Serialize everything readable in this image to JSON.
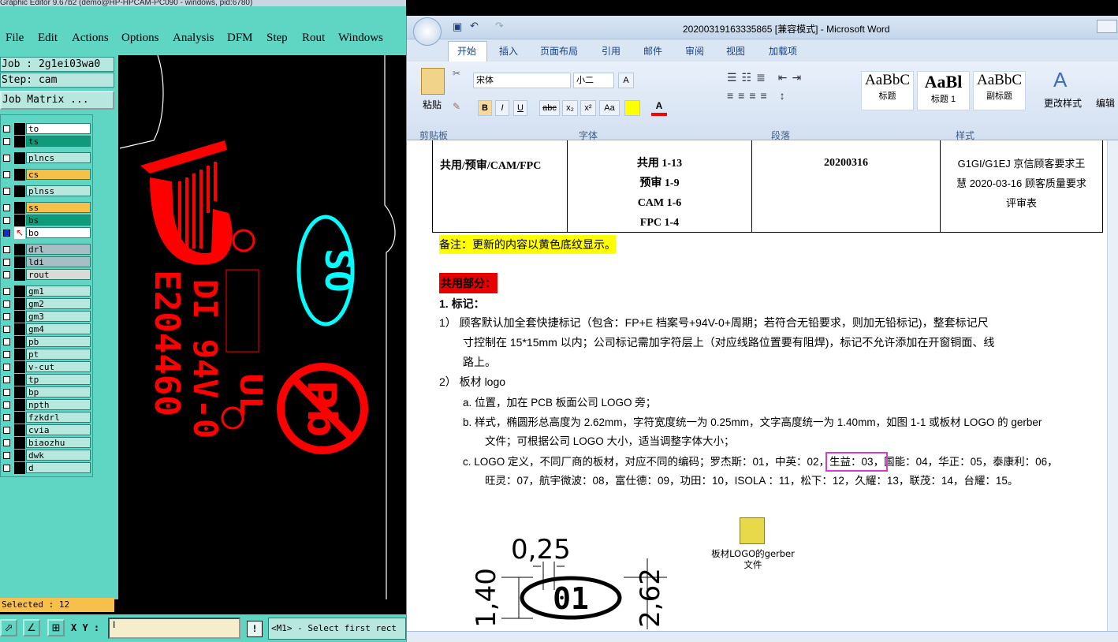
{
  "genesis": {
    "title": "Graphic Editor 9.67b2 (demo@HP-HPCAM-PC090 - windows, pid:6780)",
    "menu": [
      "File",
      "Edit",
      "Actions",
      "Options",
      "Analysis",
      "DFM",
      "Step",
      "Rout",
      "Windows"
    ],
    "job_label": "Job : 2g1ei03wa0",
    "step_label": "Step: cam",
    "job_matrix_button": "Job Matrix ...",
    "layers": [
      {
        "name": "to",
        "color": "#ffffff"
      },
      {
        "name": "ts",
        "color": "#0e9b7a"
      },
      {
        "name": "plncs",
        "color": "#b7e7df"
      },
      {
        "name": "cs",
        "color": "#f7c04a"
      },
      {
        "name": "plnss",
        "color": "#b7e7df"
      },
      {
        "name": "ss",
        "color": "#f7c04a"
      },
      {
        "name": "bs",
        "color": "#0e9b7a"
      },
      {
        "name": "bo",
        "color": "#ffffff"
      },
      {
        "name": "drl",
        "color": "#a7bfc4"
      },
      {
        "name": "ldi",
        "color": "#a7bfc4"
      },
      {
        "name": "rout",
        "color": "#d8dcd6"
      },
      {
        "name": "gm1",
        "color": "#b7e7df"
      },
      {
        "name": "gm2",
        "color": "#b7e7df"
      },
      {
        "name": "gm3",
        "color": "#b7e7df"
      },
      {
        "name": "gm4",
        "color": "#b7e7df"
      },
      {
        "name": "pb",
        "color": "#b7e7df"
      },
      {
        "name": "pt",
        "color": "#b7e7df"
      },
      {
        "name": "v-cut",
        "color": "#b7e7df"
      },
      {
        "name": "tp",
        "color": "#b7e7df"
      },
      {
        "name": "bp",
        "color": "#b7e7df"
      },
      {
        "name": "npth",
        "color": "#b7e7df"
      },
      {
        "name": "fzkdrl",
        "color": "#b7e7df"
      },
      {
        "name": "cvia",
        "color": "#b7e7df"
      },
      {
        "name": "biaozhu",
        "color": "#b7e7df"
      },
      {
        "name": "dwk",
        "color": "#b7e7df"
      },
      {
        "name": "d",
        "color": "#b7e7df"
      }
    ],
    "selected": "Selected : 12",
    "xy_label": "X Y :",
    "xy_value": "I",
    "excl": "!",
    "prompt": "<M1> - Select first rect",
    "canvas_text": {
      "os_logo": "OS",
      "os_logo_mirror": "SO",
      "board_code": "E204460",
      "ul_mark": "DI 94V-0",
      "date": "0-V49"
    }
  },
  "word": {
    "title": "20200319163335865 [兼容模式] - Microsoft Word",
    "tabs": [
      "开始",
      "插入",
      "页面布局",
      "引用",
      "邮件",
      "审阅",
      "视图",
      "加载项"
    ],
    "ribbon": {
      "paste": "粘贴",
      "clipboard": "剪贴板",
      "font_name": "宋体",
      "font_size": "小二",
      "font_group": "字体",
      "para_group": "段落",
      "style_group": "样式",
      "styles": [
        {
          "preview": "AaBbC",
          "label": "标题"
        },
        {
          "preview": "AaBl",
          "label": "标题 1"
        },
        {
          "preview": "AaBbC",
          "label": "副标题"
        }
      ],
      "change_styles": "更改样式",
      "edit": "编辑",
      "grow": "A",
      "bold": "B",
      "italic": "I",
      "underline": "U",
      "strike": "abc",
      "sub": "x₂",
      "sup": "x²",
      "case": "Aa"
    },
    "table": {
      "c1": "共用/预审/CAM/FPC",
      "c2": [
        "共用 1-13",
        "预审 1-9",
        "CAM 1-6",
        "FPC 1-4"
      ],
      "c3": "20200316",
      "c4": [
        "G1GI/G1EJ 京信顾客要求王",
        "慧 2020-03-16 顾客质量要求",
        "评审表"
      ]
    },
    "note": "备注：更新的内容以黄色底纹显示。",
    "section": "共用部分：",
    "h1": "1.   标记：",
    "p1": [
      "1） 顾客默认加全套快捷标记（包含：FP+E  档案号+94V-0+周期；若符合无铅要求，则加无铅标记)，整套标记尺",
      "寸控制在 15*15mm 以内；公司标记需加字符层上（对应线路位置要有阻焊)，标记不允许添加在开窗铜面、线",
      "路上。"
    ],
    "p2": "2） 板材 logo",
    "pa": "a.   位置，加在 PCB 板面公司 LOGO 旁；",
    "pb": [
      "b.   样式，椭圆形总高度为 2.62mm，字符宽度统一为 0.25mm，文字高度统一为 1.40mm，如图 1-1 或板材 LOGO 的 gerber",
      "文件；可根据公司 LOGO 大小，适当调整字体大小；"
    ],
    "pc1_pre": "c.   LOGO 定义，不同厂商的板材，对应不同的编码；罗杰斯：01，中英：02，",
    "pc1_hl": "生益：03，",
    "pc1_post": "国能：04，华正：05，泰康利：06，",
    "pc2": "旺灵：07，航宇微波：08，富仕德：09，功田：10，ISOLA  ：11，松下：12，久耀：13，联茂：14，台耀：15。",
    "dim_025": "0,25",
    "dim_140": "1,40",
    "dim_262": "2,62",
    "logo_num": "01",
    "obj_label": [
      "板材LOGO的gerber",
      "文件"
    ]
  }
}
